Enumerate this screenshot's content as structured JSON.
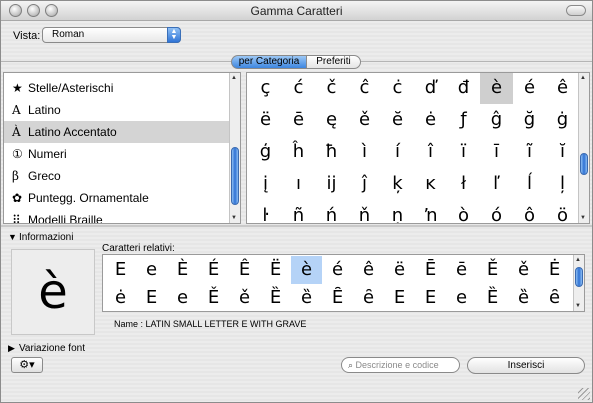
{
  "window": {
    "title": "Gamma Caratteri"
  },
  "toolbar": {
    "vista_label": "Vista:",
    "vista_value": "Roman"
  },
  "tabs": [
    {
      "label": "per Categoria"
    },
    {
      "label": "Preferiti"
    }
  ],
  "categories": [
    {
      "icon": "★",
      "icon_name": "star-icon",
      "label": "Stelle/Asterischi"
    },
    {
      "icon": "A",
      "icon_name": "latin-a-icon",
      "label": "Latino"
    },
    {
      "icon": "À",
      "icon_name": "accented-a-icon",
      "label": "Latino Accentato"
    },
    {
      "icon": "①",
      "icon_name": "circled-one-icon",
      "label": "Numeri"
    },
    {
      "icon": "β",
      "icon_name": "beta-icon",
      "label": "Greco"
    },
    {
      "icon": "✿",
      "icon_name": "ornament-icon",
      "label": "Puntegg. Ornamentale"
    },
    {
      "icon": "⠿",
      "icon_name": "braille-icon",
      "label": "Modelli Braille"
    }
  ],
  "selected_category": 2,
  "char_grid": [
    [
      "ç",
      "ć",
      "č",
      "ĉ",
      "ċ",
      "ď",
      "đ",
      "è",
      "é",
      "ê"
    ],
    [
      "ë",
      "ē",
      "ę",
      "ě",
      "ĕ",
      "ė",
      "ƒ",
      "ĝ",
      "ğ",
      "ġ"
    ],
    [
      "ģ",
      "ĥ",
      "ħ",
      "ì",
      "í",
      "î",
      "ï",
      "ī",
      "ĩ",
      "ĭ"
    ],
    [
      "į",
      "ı",
      "ĳ",
      "ĵ",
      "ķ",
      "ĸ",
      "ł",
      "ľ",
      "ĺ",
      "ļ"
    ],
    [
      "ŀ",
      "ñ",
      "ń",
      "ň",
      "ņ",
      "ŉ",
      "ò",
      "ó",
      "ô",
      "ö"
    ]
  ],
  "selected_char": "è",
  "info": {
    "label": "Informazioni",
    "char": "è",
    "related_label": "Caratteri relativi:",
    "related": [
      [
        "E",
        "e",
        "È",
        "É",
        "Ê",
        "Ë",
        "è",
        "é",
        "ê",
        "ë",
        "Ē",
        "ē",
        "Ě",
        "ě",
        "Ė"
      ],
      [
        "ė",
        "E",
        "e",
        "Ě",
        "ě",
        "Ȅ",
        "ȅ",
        "Ȇ",
        "ȇ",
        "E",
        "E",
        "e",
        "Ȅ",
        "ȅ",
        "ȇ"
      ]
    ],
    "name_line": "Name :  LATIN SMALL LETTER E WITH GRAVE"
  },
  "font_variation": {
    "label": "Variazione font"
  },
  "bottom": {
    "search_placeholder": "Descrizione e codice",
    "insert_label": "Inserisci",
    "gear_label": "⚙▾"
  },
  "colors": {
    "selection_blue": "#b5d3f7",
    "accent": "#3d86e0"
  }
}
